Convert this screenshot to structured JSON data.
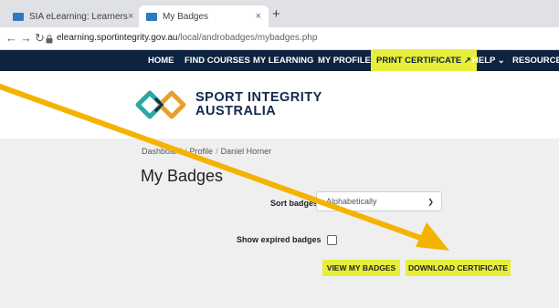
{
  "browser": {
    "tabs": [
      {
        "title": "SIA eLearning: Learners"
      },
      {
        "title": "My Badges"
      }
    ],
    "new_tab_glyph": "+",
    "close_glyph": "×",
    "url": {
      "host": "elearning.sportintegrity.gov.au",
      "path": "/local/androbadges/mybadges.php"
    }
  },
  "nav": {
    "items": [
      "HOME",
      "FIND COURSES",
      "MY LEARNING",
      "MY PROFILE"
    ],
    "print": "PRINT CERTIFICATE ↗",
    "help": "HELP ⌄",
    "resources": "RESOURCES"
  },
  "logo": {
    "line1": "SPORT INTEGRITY",
    "line2": "AUSTRALIA"
  },
  "breadcrumb": [
    "Dashboard",
    "Profile",
    "Daniel Horner"
  ],
  "page_title": "My Badges",
  "sort": {
    "label": "Sort badges",
    "value": "Alphabetically"
  },
  "expired": {
    "label": "Show expired badges",
    "checked": false
  },
  "buttons": {
    "view": "VIEW MY BADGES",
    "download": "DOWNLOAD CERTIFICATE"
  },
  "colors": {
    "navbar": "#0e2340",
    "accent": "#e6ee3a",
    "arrow": "#f5b301"
  }
}
